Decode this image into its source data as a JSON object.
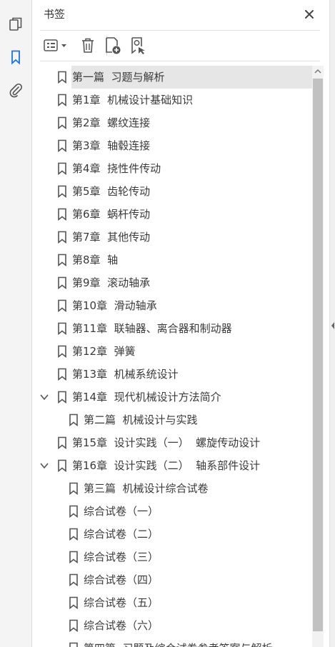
{
  "panel": {
    "title": "书签"
  },
  "rail": {
    "items": [
      {
        "icon": "pages-icon"
      },
      {
        "icon": "bookmark-icon",
        "active": true
      },
      {
        "icon": "paperclip-icon"
      }
    ]
  },
  "colors": {
    "accent": "#1473e6",
    "icon": "#555555",
    "selected": "#e6e6e6",
    "text": "#3a3a3a"
  },
  "bookmarks": [
    {
      "label": "第一篇  习题与解析",
      "level": 0,
      "selected": true
    },
    {
      "label": "第1章  机械设计基础知识",
      "level": 0
    },
    {
      "label": "第2章  螺纹连接",
      "level": 0
    },
    {
      "label": "第3章  轴毂连接",
      "level": 0
    },
    {
      "label": "第4章  挠性件传动",
      "level": 0
    },
    {
      "label": "第5章  齿轮传动",
      "level": 0
    },
    {
      "label": "第6章  蜗杆传动",
      "level": 0
    },
    {
      "label": "第7章  其他传动",
      "level": 0
    },
    {
      "label": "第8章  轴",
      "level": 0
    },
    {
      "label": "第9章  滚动轴承",
      "level": 0
    },
    {
      "label": "第10章  滑动轴承",
      "level": 0
    },
    {
      "label": "第11章  联轴器、离合器和制动器",
      "level": 0
    },
    {
      "label": "第12章  弹簧",
      "level": 0
    },
    {
      "label": "第13章  机械系统设计",
      "level": 0
    },
    {
      "label": "第14章  现代机械设计方法简介",
      "level": 0,
      "expanded": true
    },
    {
      "label": "第二篇  机械设计与实践",
      "level": 1
    },
    {
      "label": "第15章  设计实践（一）  螺旋传动设计",
      "level": 0
    },
    {
      "label": "第16章  设计实践（二）  轴系部件设计",
      "level": 0,
      "expanded": true
    },
    {
      "label": "第三篇  机械设计综合试卷",
      "level": 1
    },
    {
      "label": "综合试卷（一）",
      "level": 1
    },
    {
      "label": "综合试卷（二）",
      "level": 1
    },
    {
      "label": "综合试卷（三）",
      "level": 1
    },
    {
      "label": "综合试卷（四）",
      "level": 1
    },
    {
      "label": "综合试卷（五）",
      "level": 1
    },
    {
      "label": "综合试卷（六）",
      "level": 1
    },
    {
      "label": "第四篇  习题及综合试卷参考答案与解析",
      "level": 1
    }
  ]
}
